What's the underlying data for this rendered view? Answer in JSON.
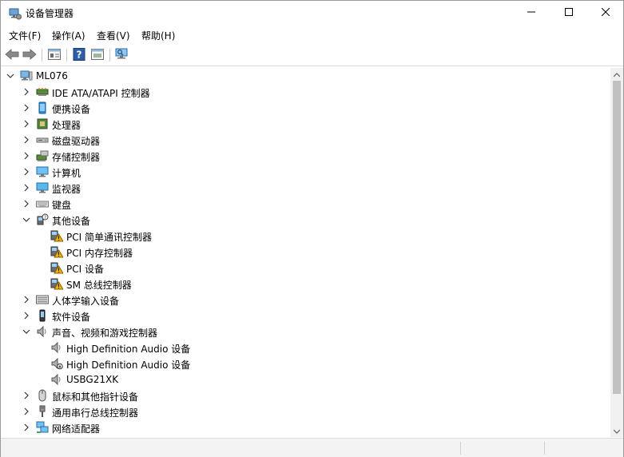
{
  "window": {
    "title": "设备管理器",
    "controls": {
      "minimize": "minimize",
      "maximize": "maximize",
      "close": "close"
    }
  },
  "menu": [
    {
      "label": "文件(F)"
    },
    {
      "label": "操作(A)"
    },
    {
      "label": "查看(V)"
    },
    {
      "label": "帮助(H)"
    }
  ],
  "toolbar": {
    "buttons": [
      {
        "name": "back-icon"
      },
      {
        "name": "forward-icon"
      },
      {
        "name": "properties-icon"
      },
      {
        "name": "help-icon"
      },
      {
        "name": "show-hide-icon"
      },
      {
        "name": "scan-hardware-icon"
      }
    ]
  },
  "tree": {
    "root": {
      "label": "ML076",
      "icon": "computer-icon",
      "expanded": true
    },
    "items": [
      {
        "label": "IDE ATA/ATAPI 控制器",
        "icon": "ide-controller-icon",
        "level": 1,
        "expand": "collapsed"
      },
      {
        "label": "便携设备",
        "icon": "portable-device-icon",
        "level": 1,
        "expand": "collapsed"
      },
      {
        "label": "处理器",
        "icon": "processor-icon",
        "level": 1,
        "expand": "collapsed"
      },
      {
        "label": "磁盘驱动器",
        "icon": "disk-drive-icon",
        "level": 1,
        "expand": "collapsed"
      },
      {
        "label": "存储控制器",
        "icon": "storage-controller-icon",
        "level": 1,
        "expand": "collapsed"
      },
      {
        "label": "计算机",
        "icon": "computer-monitor-icon",
        "level": 1,
        "expand": "collapsed"
      },
      {
        "label": "监视器",
        "icon": "monitor-icon",
        "level": 1,
        "expand": "collapsed"
      },
      {
        "label": "键盘",
        "icon": "keyboard-icon",
        "level": 1,
        "expand": "collapsed"
      },
      {
        "label": "其他设备",
        "icon": "other-devices-icon",
        "level": 1,
        "expand": "expanded"
      },
      {
        "label": "PCI 简单通讯控制器",
        "icon": "warning-device-icon",
        "level": 2,
        "expand": "none"
      },
      {
        "label": "PCI 内存控制器",
        "icon": "warning-device-icon",
        "level": 2,
        "expand": "none"
      },
      {
        "label": "PCI 设备",
        "icon": "warning-device-icon",
        "level": 2,
        "expand": "none"
      },
      {
        "label": "SM 总线控制器",
        "icon": "warning-device-icon",
        "level": 2,
        "expand": "none"
      },
      {
        "label": "人体学输入设备",
        "icon": "hid-icon",
        "level": 1,
        "expand": "collapsed"
      },
      {
        "label": "软件设备",
        "icon": "software-device-icon",
        "level": 1,
        "expand": "collapsed"
      },
      {
        "label": "声音、视频和游戏控制器",
        "icon": "speaker-icon",
        "level": 1,
        "expand": "expanded"
      },
      {
        "label": "High Definition Audio 设备",
        "icon": "speaker-icon",
        "level": 2,
        "expand": "none"
      },
      {
        "label": "High Definition Audio 设备",
        "icon": "speaker-disabled-icon",
        "level": 2,
        "expand": "none"
      },
      {
        "label": "USBG21XK",
        "icon": "speaker-icon",
        "level": 2,
        "expand": "none"
      },
      {
        "label": "鼠标和其他指针设备",
        "icon": "mouse-icon",
        "level": 1,
        "expand": "collapsed"
      },
      {
        "label": "通用串行总线控制器",
        "icon": "usb-icon",
        "level": 1,
        "expand": "collapsed"
      },
      {
        "label": "网络适配器",
        "icon": "network-adapter-icon",
        "level": 1,
        "expand": "collapsed"
      }
    ]
  },
  "colors": {
    "accent": "#1a74c4",
    "warning": "#f0b400",
    "selection": "#cce8ff"
  }
}
